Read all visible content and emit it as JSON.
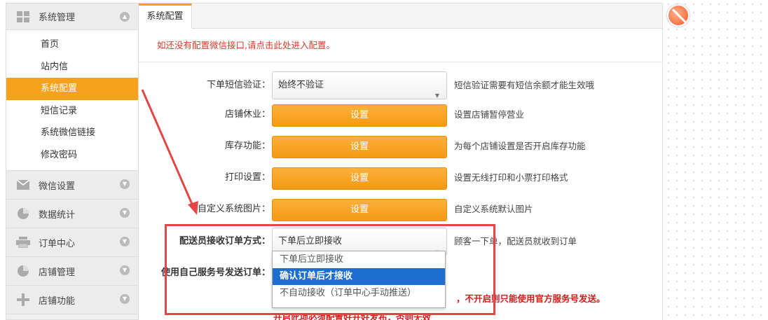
{
  "sidebar": {
    "sections": [
      {
        "title": "系统管理",
        "icon": "grid-icon",
        "expanded": true,
        "items": [
          "首页",
          "站内信",
          "系统配置",
          "短信记录",
          "系统微信链接",
          "修改密码"
        ],
        "active_index": 2
      },
      {
        "title": "微信设置",
        "icon": "mail-icon",
        "expanded": false
      },
      {
        "title": "数据统计",
        "icon": "pie-chart-icon",
        "expanded": false
      },
      {
        "title": "订单中心",
        "icon": "printer-icon",
        "expanded": false
      },
      {
        "title": "店铺管理",
        "icon": "pie-chart-icon",
        "expanded": false
      },
      {
        "title": "店铺功能",
        "icon": "plus-icon",
        "expanded": false
      }
    ]
  },
  "main": {
    "tab": "系统配置",
    "notice": "如还没有配置微信接口,请点击此处进入配置。",
    "rows": [
      {
        "label": "下单短信验证：",
        "control": "select",
        "value": "始终不验证",
        "hint": "短信验证需要有短信余额才能生效哦"
      },
      {
        "label": "店铺休业：",
        "control": "button",
        "value": "设置",
        "hint": "设置店铺暂停营业"
      },
      {
        "label": "库存功能：",
        "control": "button",
        "value": "设置",
        "hint": "为每个店铺设置是否开启库存功能"
      },
      {
        "label": "打印设置：",
        "control": "button",
        "value": "设置",
        "hint": "设置无线打印和小票打印格式"
      },
      {
        "label": "自定义系统图片：",
        "control": "button",
        "value": "设置",
        "hint": "自定义系统默认图片"
      },
      {
        "label": "配送员接收订单方式：",
        "control": "select",
        "value": "下单后立即接收",
        "hint": "顾客一下单，配送员就收到订单"
      },
      {
        "label": "使用自己服务号发送订单：",
        "control": "none"
      }
    ],
    "dropdown_options": [
      "下单后立即接收",
      "确认订单后才接收",
      "不自动接收（订单中心手动推送）"
    ],
    "dropdown_highlight": 1,
    "warning": "，不开启则只能使用官方服务号发送。",
    "warning2": "开启此项必须配置好开好发布，否则无效"
  },
  "colors": {
    "accent": "#f7a21c",
    "highlight": "#1e6ecf",
    "warning": "#d61b1b",
    "annotation": "#e64545"
  }
}
